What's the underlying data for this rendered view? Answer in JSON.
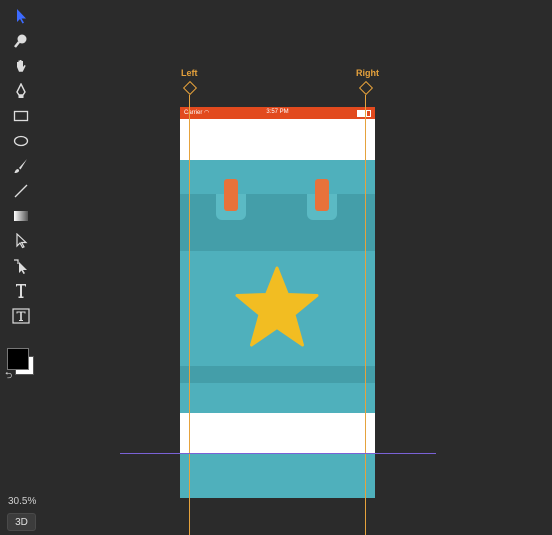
{
  "tools": [
    {
      "name": "move-tool-icon",
      "selected": true
    },
    {
      "name": "zoom-tool-icon"
    },
    {
      "name": "hand-tool-icon"
    },
    {
      "name": "pen-tool-icon"
    },
    {
      "name": "rectangle-tool-icon"
    },
    {
      "name": "ellipse-tool-icon"
    },
    {
      "name": "brush-tool-icon"
    },
    {
      "name": "line-tool-icon"
    },
    {
      "name": "gradient-tool-icon"
    },
    {
      "name": "direct-select-tool-icon"
    },
    {
      "name": "path-select-tool-icon"
    },
    {
      "name": "type-tool-icon"
    },
    {
      "name": "text-box-tool-icon"
    }
  ],
  "colors": {
    "foreground": "#000000",
    "background": "#ffffff",
    "accent": "#3d6bff",
    "guide": "#e6a23c",
    "hguide": "#7a62d6"
  },
  "zoom": "30.5%",
  "button_3d": "3D",
  "guides": {
    "left_label": "Left",
    "right_label": "Right"
  },
  "artboard": {
    "status": {
      "carrier": "Carrier",
      "time": "3:57 PM"
    },
    "colors": {
      "teal": "#4fb0bc",
      "teal_dark": "#449ea9",
      "orange": "#e8723a",
      "star": "#f2bd22",
      "status_bar": "#e24a1e"
    }
  }
}
